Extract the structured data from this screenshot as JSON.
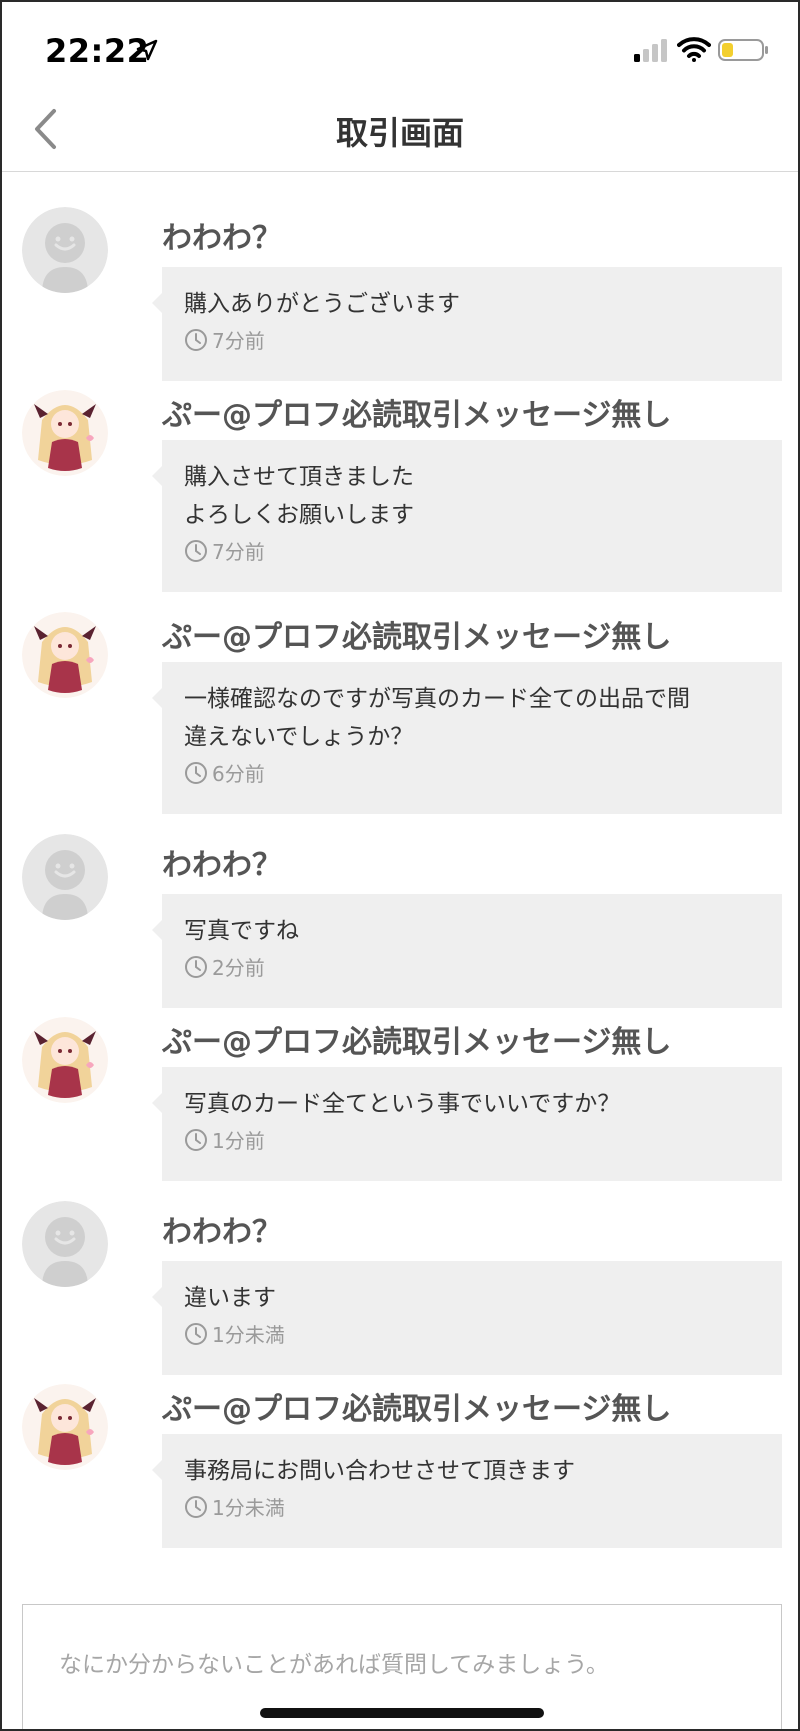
{
  "status_bar": {
    "time": "22:22"
  },
  "nav": {
    "title": "取引画面"
  },
  "messages": [
    {
      "sender": "わわわ？",
      "text": "購入ありがとうございます",
      "time": "7分前",
      "avatar": "default"
    },
    {
      "sender": "ぷー@プロフ必読取引メッセージ無し",
      "text": "購入させて頂きました\nよろしくお願いします",
      "time": "7分前",
      "avatar": "anime"
    },
    {
      "sender": "ぷー@プロフ必読取引メッセージ無し",
      "text": "一様確認なのですが写真のカード全ての出品で間\n違えないでしょうか？",
      "time": "6分前",
      "avatar": "anime"
    },
    {
      "sender": "わわわ？",
      "text": "写真ですね",
      "time": "2分前",
      "avatar": "default"
    },
    {
      "sender": "ぷー@プロフ必読取引メッセージ無し",
      "text": "写真のカード全てという事でいいですか？",
      "time": "1分前",
      "avatar": "anime"
    },
    {
      "sender": "わわわ？",
      "text": "違います",
      "time": "1分未満",
      "avatar": "default"
    },
    {
      "sender": "ぷー@プロフ必読取引メッセージ無し",
      "text": "事務局にお問い合わせさせて頂きます",
      "time": "1分未満",
      "avatar": "anime"
    }
  ],
  "input": {
    "placeholder": "なにか分からないことがあれば質問してみましょう。"
  }
}
